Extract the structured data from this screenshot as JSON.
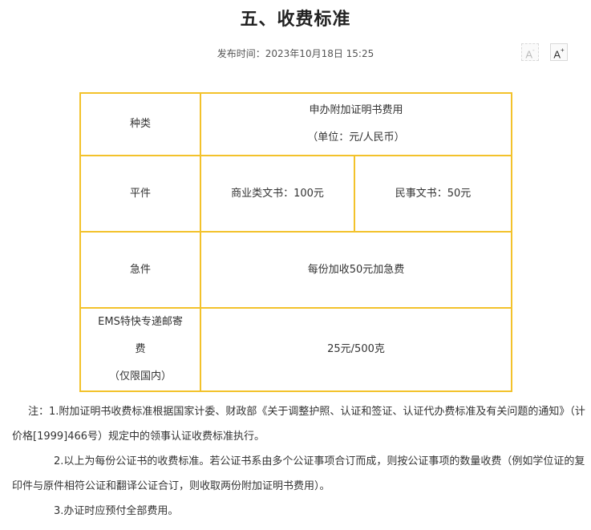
{
  "article": {
    "title": "五、收费标准",
    "publish_label": "发布时间：",
    "publish_time": "2023年10月18日  15:25",
    "font_decrease": "A",
    "font_decrease_sign": "-",
    "font_increase": "A",
    "font_increase_sign": "+"
  },
  "table": {
    "header": {
      "label": "种类",
      "title": "申办附加证明书费用",
      "unit": "（单位：元/人民币）"
    },
    "rows": [
      {
        "label": "平件",
        "commercial": "商业类文书：100元",
        "civil": "民事文书：50元"
      },
      {
        "label": "急件",
        "value": "每份加收50元加急费"
      },
      {
        "label_line1": "EMS特快专递邮寄",
        "label_line2": "费",
        "label_line3": "（仅限国内）",
        "value": "25元/500克"
      }
    ]
  },
  "notes": [
    "注：1.附加证明书收费标准根据国家计委、财政部《关于调整护照、认证和签证、认证代办费标准及有关问题的通知》（计价格[1999]466号）规定中的领事认证收费标准执行。",
    "2.以上为每份公证书的收费标准。若公证书系由多个公证事项合订而成，则按公证事项的数量收费（例如学位证的复印件与原件相符公证和翻译公证合订，则收取两份附加证明书费用）。",
    "3.办证时应预付全部费用。"
  ]
}
